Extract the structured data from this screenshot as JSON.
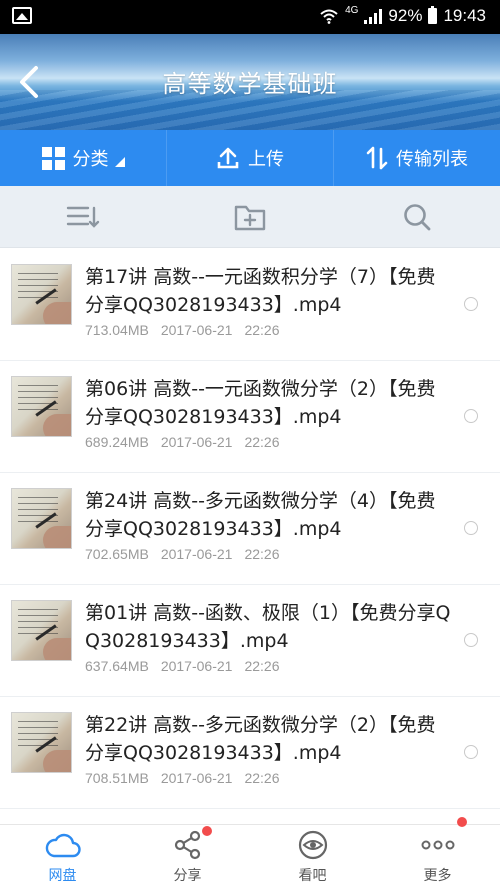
{
  "status_bar": {
    "network_type": "4G",
    "battery": "92%",
    "time": "19:43"
  },
  "header": {
    "title": "高等数学基础班",
    "back_icon": "back-arrow-icon"
  },
  "toolbar": {
    "category_label": "分类",
    "upload_label": "上传",
    "transfer_label": "传输列表"
  },
  "subbar": {
    "sort_icon": "sort-icon",
    "new_folder_icon": "new-folder-icon",
    "search_icon": "search-icon"
  },
  "files": [
    {
      "name": "第17讲 高数--一元函数积分学（7）【免费分享QQ3028193433】.mp4",
      "size": "713.04MB",
      "date": "2017-06-21",
      "time": "22:26"
    },
    {
      "name": "第06讲 高数--一元函数微分学（2）【免费分享QQ3028193433】.mp4",
      "size": "689.24MB",
      "date": "2017-06-21",
      "time": "22:26"
    },
    {
      "name": "第24讲 高数--多元函数微分学（4）【免费分享QQ3028193433】.mp4",
      "size": "702.65MB",
      "date": "2017-06-21",
      "time": "22:26"
    },
    {
      "name": "第01讲 高数--函数、极限（1）【免费分享QQ3028193433】.mp4",
      "size": "637.64MB",
      "date": "2017-06-21",
      "time": "22:26"
    },
    {
      "name": "第22讲 高数--多元函数微分学（2）【免费分享QQ3028193433】.mp4",
      "size": "708.51MB",
      "date": "2017-06-21",
      "time": "22:26"
    }
  ],
  "bottom_nav": {
    "items": [
      {
        "label": "网盘",
        "icon": "cloud-icon",
        "active": true
      },
      {
        "label": "分享",
        "icon": "share-icon",
        "badge": true
      },
      {
        "label": "看吧",
        "icon": "eye-icon"
      },
      {
        "label": "更多",
        "icon": "more-icon",
        "badge": true
      }
    ]
  },
  "colors": {
    "accent": "#2d8bf0",
    "badge": "#f24c4c",
    "meta_text": "#9a9a9a"
  }
}
